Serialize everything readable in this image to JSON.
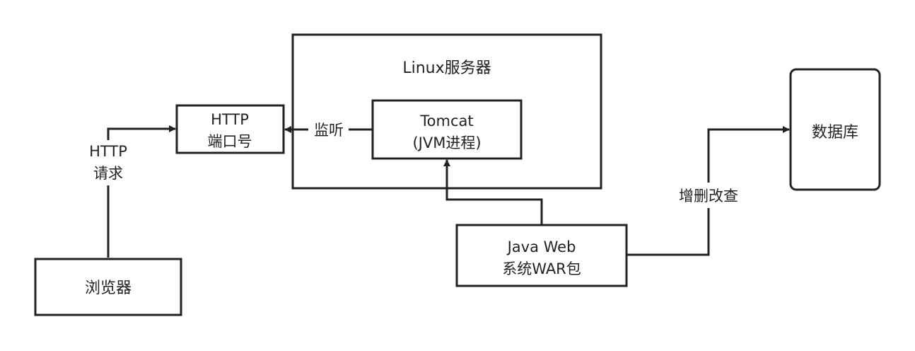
{
  "nodes": {
    "browser": "浏览器",
    "http_port": [
      "HTTP",
      "端口号"
    ],
    "linux_server": "Linux服务器",
    "tomcat": [
      "Tomcat",
      "(JVM进程)"
    ],
    "war_package": [
      "Java Web",
      "系统WAR包"
    ],
    "database": "数据库"
  },
  "edges": {
    "http_request": [
      "HTTP",
      "请求"
    ],
    "listen": "监听",
    "crud": "增删改查"
  },
  "colors": {
    "stroke": "#222222",
    "background": "#ffffff"
  }
}
